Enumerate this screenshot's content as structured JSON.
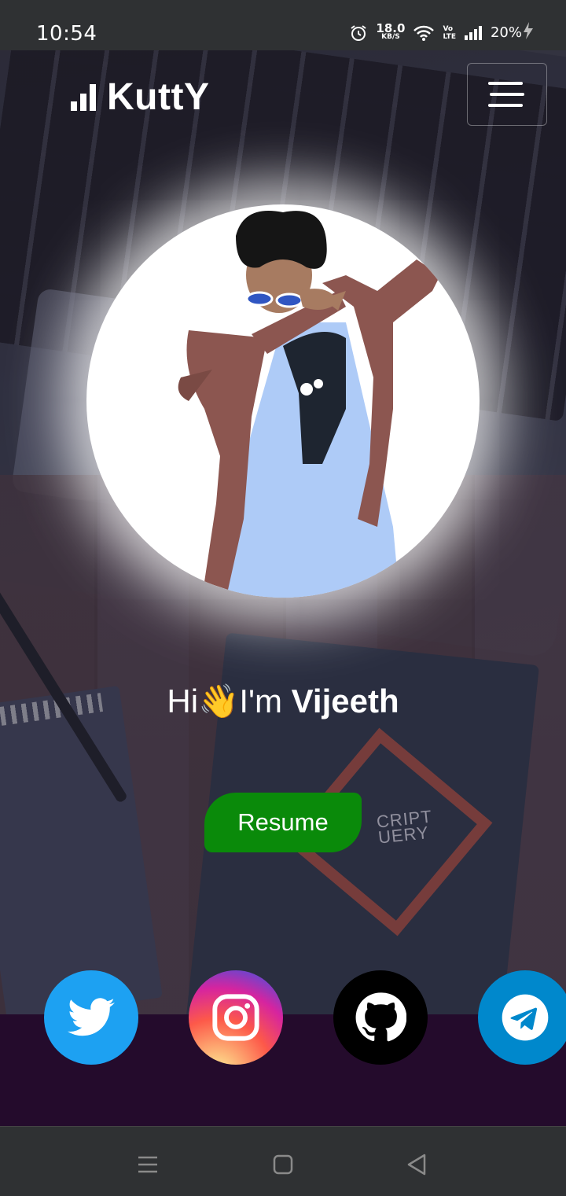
{
  "status_bar": {
    "time": "10:54",
    "net_speed_value": "18.0",
    "net_speed_unit": "KB/S",
    "volte_top": "Vo",
    "volte_bottom": "LTE",
    "battery": "20%"
  },
  "header": {
    "brand": "KuttY",
    "menu_icon": "hamburger-menu-icon"
  },
  "hero": {
    "greeting_prefix": "Hi",
    "wave_emoji": "👋",
    "greeting_middle": "I'm ",
    "name": "Vijeeth",
    "resume_label": "Resume"
  },
  "background_book": {
    "line1": "CRIPT",
    "line2": "UERY"
  },
  "socials": [
    {
      "name": "twitter",
      "icon": "twitter-icon",
      "color": "#1da1f2"
    },
    {
      "name": "instagram",
      "icon": "instagram-icon",
      "color": "#d6249f"
    },
    {
      "name": "github",
      "icon": "github-icon",
      "color": "#000000"
    },
    {
      "name": "telegram",
      "icon": "telegram-icon",
      "color": "#0088cc"
    }
  ],
  "colors": {
    "resume_green": "#0a8a0a",
    "bottom_strip": "#240b2c",
    "system_bar": "#2f3133"
  }
}
